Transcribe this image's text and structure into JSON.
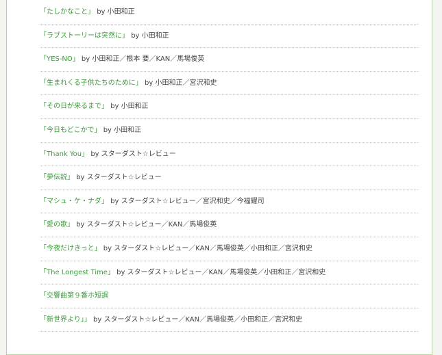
{
  "colors": {
    "link": "#3b9b3b",
    "text": "#444444",
    "border": "#b9d3a8",
    "divider": "#c8c8c8",
    "background": "#f3f4ef"
  },
  "songs": [
    {
      "title": "「たしかなこと」",
      "by": "by 小田和正"
    },
    {
      "title": "「ラブストーリーは突然に」",
      "by": "by 小田和正"
    },
    {
      "title": "「YES-NO」",
      "by": "by 小田和正／根本 要／KAN／馬場俊英"
    },
    {
      "title": "「生まれくる子供たちのために」",
      "by": "by 小田和正／宮沢和史"
    },
    {
      "title": "「その日が来るまで」",
      "by": "by 小田和正"
    },
    {
      "title": "「今日もどこかで」",
      "by": "by 小田和正"
    },
    {
      "title": "「Thank You」",
      "by": "by スターダスト☆レビュー"
    },
    {
      "title": "「夢伝説」",
      "by": "by スターダスト☆レビュー"
    },
    {
      "title": "「マシュ・ケ・ナダ」",
      "by": "by スターダスト☆レビュー／宮沢和史／今福耀司"
    },
    {
      "title": "「愛の歌」",
      "by": "by スターダスト☆レビュー／KAN／馬場俊英"
    },
    {
      "title": "「今夜だけきっと」",
      "by": "by スターダスト☆レビュー／KAN／馬場俊英／小田和正／宮沢和史"
    },
    {
      "title": "「The Longest Time」",
      "by": "by スターダスト☆レビュー／KAN／馬場俊英／小田和正／宮沢和史"
    },
    {
      "title": "「交響曲第９番ホ短調",
      "by": ""
    },
    {
      "title": "「新世界より」」",
      "by": "by スターダスト☆レビュー／KAN／馬場俊英／小田和正／宮沢和史"
    }
  ]
}
